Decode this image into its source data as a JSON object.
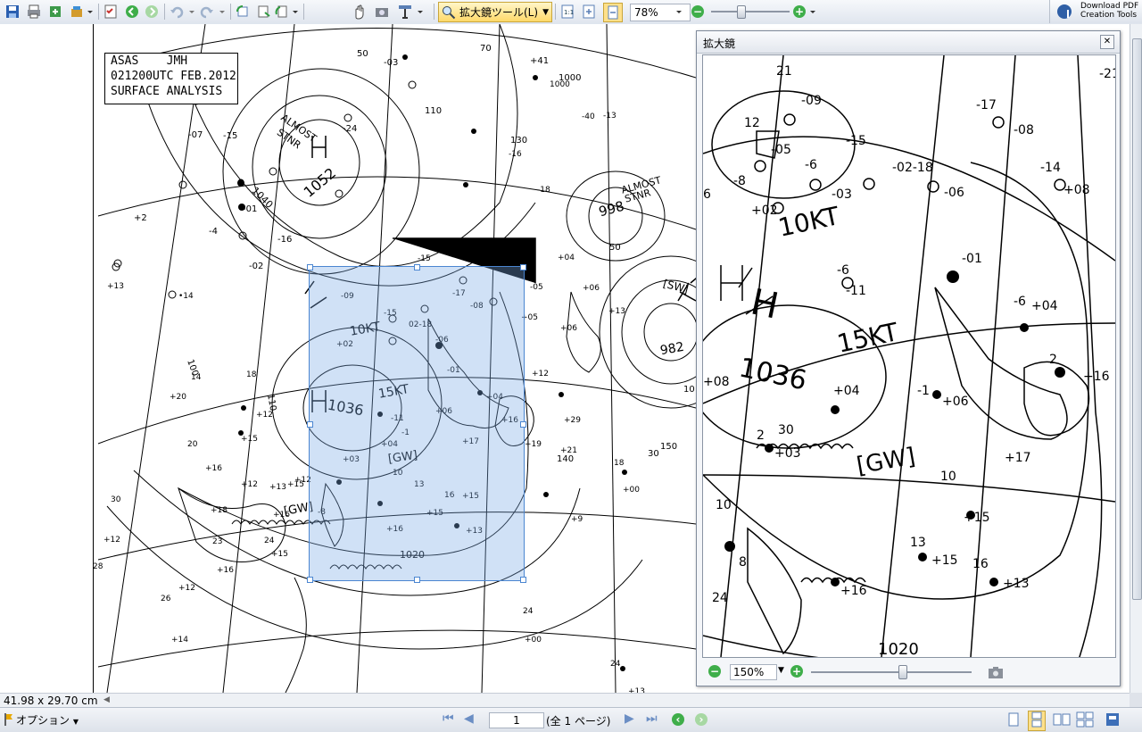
{
  "toolbar": {
    "tool_select_label": "拡大鏡ツール(L)",
    "zoom_value": "78%",
    "download_line1": "Download PDF",
    "download_line2": "Creation Tools"
  },
  "map": {
    "title_line1": "ASAS    JMH",
    "title_line2": "021200UTC FEB.2012",
    "title_line3": "SURFACE ANALYSIS",
    "labels": {
      "almost_stnr_1": "ALMOST",
      "almost_stnr_2": "STNR",
      "high_pressure_1052": "1052",
      "low_pressure_998": "998",
      "low_pressure_982": "982",
      "high_pressure_1036": "1036",
      "wind_15kt": "15KT",
      "wind_10kt": "10KT",
      "gw_1": "[GW]",
      "gw_2": "[GW]",
      "sw": "[SW]",
      "isobar_1020": "1020",
      "isobar_1040": "1040",
      "isobar_1000": "1000",
      "lat_140": "140",
      "lat_150": "150",
      "lat_130": "130",
      "lat_120": "120",
      "lat_110": "110",
      "lat_100": "100",
      "lat_70": "70",
      "lat_50": "50",
      "lat_30": "30"
    }
  },
  "page_size": "41.98 x 29.70 cm",
  "statusbar": {
    "options_label": "オプション",
    "page_current": "1",
    "page_total": "(全 1 ページ)"
  },
  "magnifier": {
    "title": "拡大鏡",
    "zoom": "150%",
    "labels": {
      "high_1036": "1036",
      "wind_15kt": "15KT",
      "wind_10kt": "10KT",
      "gw": "[GW]",
      "isobar_1020": "1020",
      "h_mark": "H"
    }
  }
}
